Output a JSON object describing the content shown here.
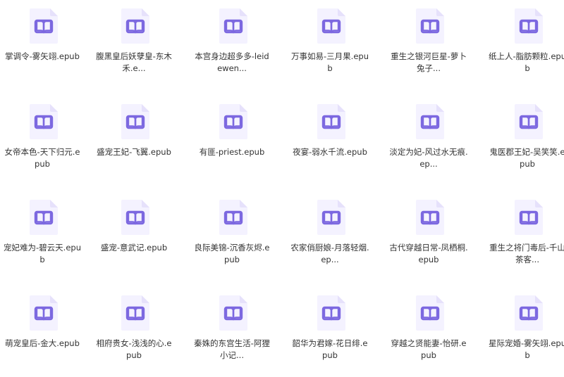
{
  "colors": {
    "icon_bg": "#f4f2ff",
    "icon_fold": "#e6e1fb",
    "icon_accent": "#7c68e0",
    "text": "#333333"
  },
  "file_icon_name": "ebook-file-icon",
  "files": [
    {
      "name": "掌调令-雾矢翊.epub"
    },
    {
      "name": "腹黑皇后妖孽皇-东木禾.e..."
    },
    {
      "name": "本宫身边超多多-leidewen..."
    },
    {
      "name": "万事如易-三月果.epub"
    },
    {
      "name": "重生之银河巨星-萝卜兔子..."
    },
    {
      "name": "纸上人-脂肪颗粒.epub"
    },
    {
      "name": "女帝本色-天下归元.epub"
    },
    {
      "name": "盛宠王妃-飞翼.epub"
    },
    {
      "name": "有匪-priest.epub"
    },
    {
      "name": "夜宴-弱水千流.epub"
    },
    {
      "name": "淡定为妃-风过水无痕.ep..."
    },
    {
      "name": "鬼医郡王妃-吴笑笑.epub"
    },
    {
      "name": "宠妃难为-碧云天.epub"
    },
    {
      "name": "盛宠-意武记.epub"
    },
    {
      "name": "良际美锦-沉香灰烬.epub"
    },
    {
      "name": "农家俏厨娘-月落轻烟.ep..."
    },
    {
      "name": "古代穿越日常-凤栖桐.epub"
    },
    {
      "name": "重生之将门毒后-千山茶客..."
    },
    {
      "name": "萌宠皇后-金大.epub"
    },
    {
      "name": "相府贵女-浅浅的心.epub"
    },
    {
      "name": "秦姝的东宫生活-阿狸小记..."
    },
    {
      "name": "韶华为君嫁-花日绯.epub"
    },
    {
      "name": "穿越之贤能妻-怡研.epub"
    },
    {
      "name": "星际宠婚-雾矢翊.epub"
    }
  ]
}
